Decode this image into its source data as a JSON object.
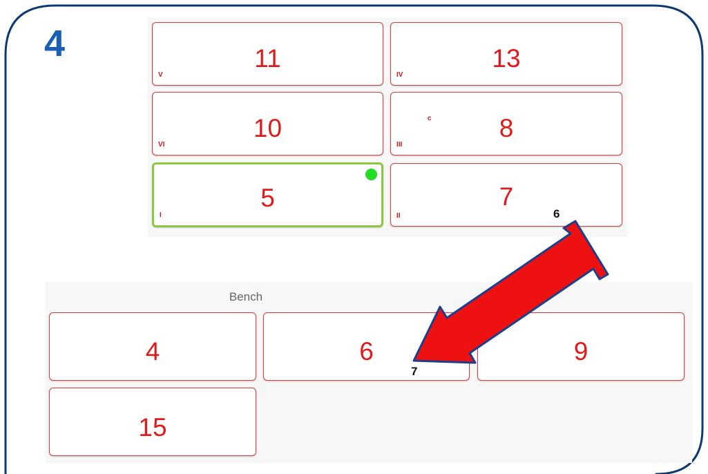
{
  "step_number": "4",
  "colors": {
    "frame": "#0e3a73",
    "step": "#1a5fb4",
    "number": "#e01a1a",
    "selected_border": "#8dc63f",
    "indicator": "#22dd22",
    "arrow_fill": "#ee1111",
    "arrow_stroke": "#1b3f8b"
  },
  "court": {
    "players": [
      {
        "number": "11",
        "position": "V"
      },
      {
        "number": "13",
        "position": "IV"
      },
      {
        "number": "10",
        "position": "VI"
      },
      {
        "number": "8",
        "position": "III",
        "captain": "c"
      },
      {
        "number": "5",
        "position": "I",
        "selected": true
      },
      {
        "number": "7",
        "position": "II",
        "substitute": "6"
      }
    ]
  },
  "bench": {
    "label": "Bench",
    "players": [
      {
        "number": "4"
      },
      {
        "number": "6",
        "substitute": "7"
      },
      {
        "number": "9"
      },
      {
        "number": "15"
      }
    ]
  },
  "swap_arrow_icon": "double-headed-arrow-icon"
}
